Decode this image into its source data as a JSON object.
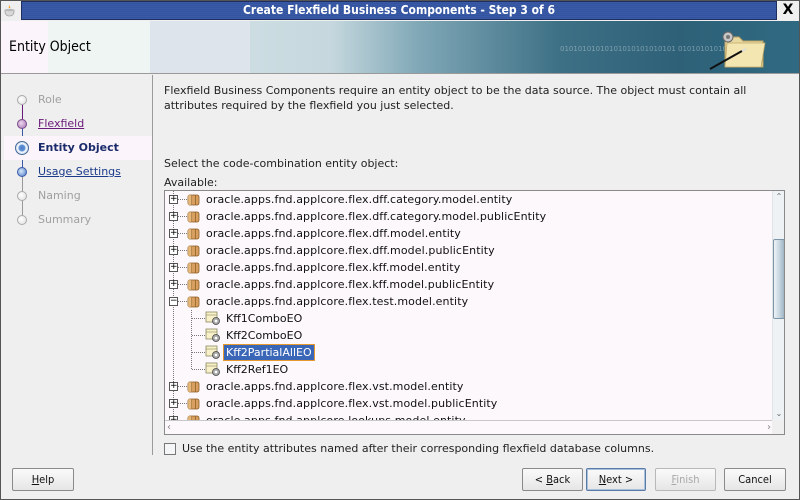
{
  "window": {
    "title": "Create Flexfield Business Components - Step 3 of 6",
    "close_label": "X"
  },
  "header": {
    "title": "Entity Object",
    "binary_text": "01010101010101010101010101 01010101010"
  },
  "nav": {
    "items": [
      {
        "label": "Role",
        "state": "disabled"
      },
      {
        "label": "Flexfield",
        "state": "visited"
      },
      {
        "label": "Entity Object",
        "state": "current"
      },
      {
        "label": "Usage Settings",
        "state": "link"
      },
      {
        "label": "Naming",
        "state": "disabled"
      },
      {
        "label": "Summary",
        "state": "disabled"
      }
    ]
  },
  "main": {
    "intro": "Flexfield Business Components require an entity object to be the data source. The object must contain all attributes required by the flexfield you just selected.",
    "select_label": "Select the code-combination entity object:",
    "available_label": "Available:",
    "tree": {
      "rows": [
        {
          "type": "package",
          "label": "oracle.apps.fnd.applcore.flex.dff.category.model.entity",
          "expanded": false
        },
        {
          "type": "package",
          "label": "oracle.apps.fnd.applcore.flex.dff.category.model.publicEntity",
          "expanded": false
        },
        {
          "type": "package",
          "label": "oracle.apps.fnd.applcore.flex.dff.model.entity",
          "expanded": false
        },
        {
          "type": "package",
          "label": "oracle.apps.fnd.applcore.flex.dff.model.publicEntity",
          "expanded": false
        },
        {
          "type": "package",
          "label": "oracle.apps.fnd.applcore.flex.kff.model.entity",
          "expanded": false
        },
        {
          "type": "package",
          "label": "oracle.apps.fnd.applcore.flex.kff.model.publicEntity",
          "expanded": false
        },
        {
          "type": "package",
          "label": "oracle.apps.fnd.applcore.flex.test.model.entity",
          "expanded": true
        },
        {
          "type": "entity",
          "label": "Kff1ComboEO",
          "selected": false
        },
        {
          "type": "entity",
          "label": "Kff2ComboEO",
          "selected": false
        },
        {
          "type": "entity",
          "label": "Kff2PartialAllEO",
          "selected": true
        },
        {
          "type": "entity",
          "label": "Kff2Ref1EO",
          "selected": false
        },
        {
          "type": "package",
          "label": "oracle.apps.fnd.applcore.flex.vst.model.entity",
          "expanded": false
        },
        {
          "type": "package",
          "label": "oracle.apps.fnd.applcore.flex.vst.model.publicEntity",
          "expanded": false
        },
        {
          "type": "package",
          "label": "oracle.apps.fnd.applcore.lookups.model.entity",
          "expanded": false
        }
      ]
    },
    "checkbox": {
      "label": "Use the entity attributes named after their corresponding flexfield database columns.",
      "checked": false
    }
  },
  "buttons": {
    "help": {
      "label": "Help",
      "mnemonic": "H"
    },
    "back": {
      "label": "< Back",
      "mnemonic": "B"
    },
    "next": {
      "label": "Next >",
      "mnemonic": "N"
    },
    "finish": {
      "label": "Finish",
      "mnemonic": "F",
      "disabled": true
    },
    "cancel": {
      "label": "Cancel"
    }
  },
  "colors": {
    "title_bar": "#3355a0",
    "selection": "#3a66b8",
    "selection_outline": "#e69a2e",
    "visited_link": "#6a1a7a",
    "link": "#1a3a8a"
  }
}
